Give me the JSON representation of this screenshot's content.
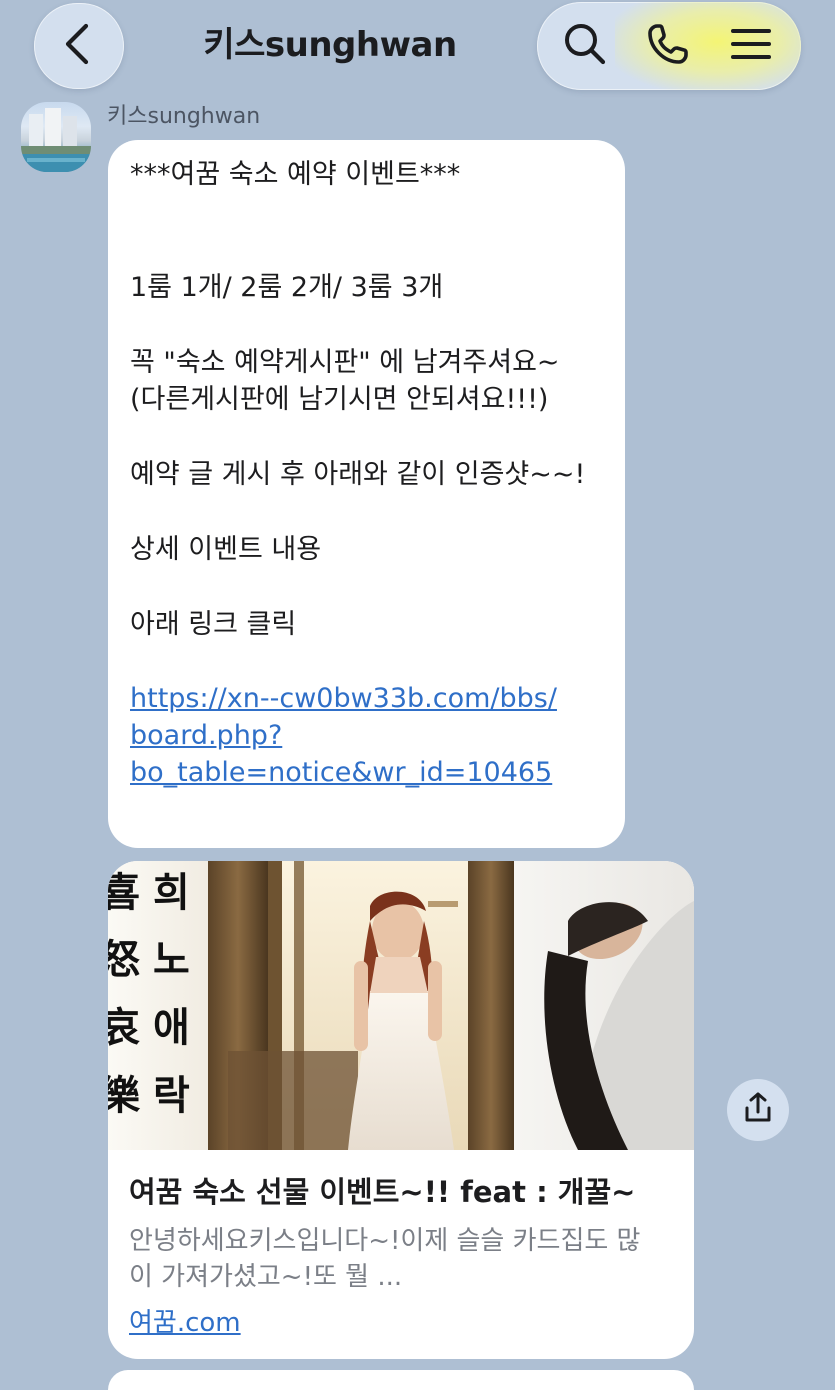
{
  "header": {
    "back_icon": "chevron-left-icon",
    "title": "키스sunghwan",
    "actions": [
      "search-icon",
      "phone-icon",
      "menu-icon"
    ]
  },
  "message": {
    "sender_name": "키스sunghwan",
    "lines": [
      "***여꿈 숙소 예약 이벤트***",
      "1룸 1개/ 2룸 2개/ 3룸 3개",
      "꼭  \"숙소 예약게시판\" 에 남겨주셔요~",
      "(다른게시판에 남기시면 안되셔요!!!)",
      "예약 글 게시 후 아래와 같이 인증샷~~!",
      "상세 이벤트 내용",
      "아래 링크 클릭"
    ],
    "link_lines": [
      "https://xn--cw0bw33b.com/bbs/",
      "board.php?",
      "bo_table=notice&wr_id=10465"
    ]
  },
  "preview": {
    "title": "여꿈 숙소 선물 이벤트~!! feat : 개꿀~",
    "description_lines": [
      "안녕하세요키스입니다~!이제 슬슬 카드집도 많",
      "이 가져가셨고~!또 뭘 ..."
    ],
    "domain": "여꿈.com",
    "image_characters": [
      "희",
      "노",
      "애",
      "락"
    ],
    "share_icon": "share-icon"
  },
  "colors": {
    "chat_background": "#aebfd3",
    "bubble": "#ffffff",
    "link": "#2f6fc8",
    "header_pill": "#d6e2f0",
    "highlight": "#f6f66e"
  }
}
